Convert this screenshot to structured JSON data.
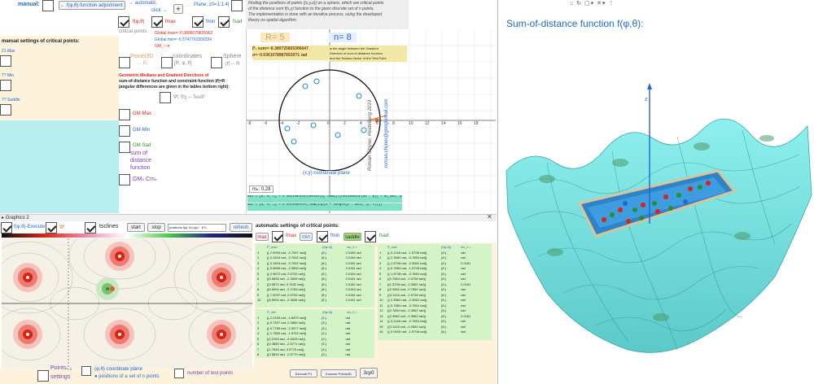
{
  "top": {
    "manual": "manual:",
    "phi_adjust": "f(φ,θ)-function adjustment:",
    "auto": "automatic.",
    "click": "click →",
    "plus": "+",
    "plane": "Plane: z0=1:1.4|",
    "desc": [
      "Finding the positions of points {(x,y,z)} on a sphere, which are critical points",
      "of the distance sum f(x,y) function to the given discrete set of n points.",
      "The implementation is done with an iterative process, using the developed",
      "theory on spatial algorithm."
    ]
  },
  "checks": {
    "fphi": "f(φ,θ)",
    "fmax": "fmax",
    "fmin": "fmin",
    "fsad": "fsad",
    "critical": "critical points"
  },
  "global": {
    "max": "Global  max=~0.3896079625962",
    "min": "Global  min=~0.3747761559334",
    "gm": "GM_~-π"
  },
  "points3d": "Points3D",
  "arrow": "→ P₁",
  "coordinates": "coordinates",
  "coords_val": "[R; φ; θ]",
  "sphere": "Sphere",
  "sphere_val": "|r⃗| ─ R",
  "geo": [
    "Geometric Medians and Gradient Directions of",
    "sum-of-distance function and constraint-function |r⃗|=R",
    "(angular differences are given in the tables bottom right):"
  ],
  "grad": "∇f, ∇χ ─ TestP",
  "gm_list": [
    "GM-Max",
    "GM-Min",
    "GM-Sad",
    "sum of",
    "distance",
    "function",
    "GMₙ Cmₙ"
  ],
  "manual_settings": "manual settings of critical points:",
  "side_items": [
    "21 Max",
    "7? Min",
    "7? Saddle"
  ],
  "graph": {
    "r": "R= 5",
    "n": "n= 8",
    "p_line1": "P₁  sum=~8.380725805306647",
    "p_line2": "   σ=~0.03610789876530?1 rad",
    "angle_note": [
      "is the angle between the Gradient",
      "Direction of sum-of-distance function",
      "and the Radius-Vector of the Test-Point"
    ],
    "author": "Roman Chijner, Heidelberg  2019",
    "email": "roman.chijner@googlemail.com",
    "xy_label": "(x,y) coordinate plane",
    "m": "mₙ: 0.28",
    "formula1": "AX1 = {0, 0, C} + R UnitVector(Vector(η, Sum(ζ/(UnitVector(AX - p)) * m)_AX1, p, 1}))}",
    "formula2": "AX2 = {0, 0, C} + R UnitVector(-Sum(Zip(z * Length(p - AX1), p, P))})",
    "xticks": [
      "-8",
      "-6",
      "-4",
      "-2",
      "0",
      "2",
      "4",
      "6",
      "8",
      "10",
      "12",
      "14",
      "16",
      "18"
    ],
    "yticks": [
      "6",
      "4",
      "2",
      "-2",
      "-4",
      "-6"
    ]
  },
  "graphics2": {
    "title": "Graphics 2",
    "fe": "f(φ,θ)-Execute",
    "fe2": "∇f",
    "tsclines": "tsclines",
    "start": "start",
    "stop": "stop",
    "positions": "positions f(φ, θ)=(φ1 · θ?)",
    "refresh": "refresh"
  },
  "auto_settings": "automatic settings of critical points:",
  "crit_btns": {
    "max": "max",
    "fmax": "fmax",
    "min": "min",
    "fmin": "fmin",
    "saddle": "saddle",
    "fsad": "fsad"
  },
  "table1": {
    "head": [
      "P_max",
      "(f(φ,θ))",
      "Δα_n ="
    ],
    "rows": [
      [
        "1",
        "{(-7.5993 rad, -2.7997 rad)}",
        "{8.}",
        "2.0180 rad"
      ],
      [
        "2",
        "{(-3.1816 rad, -0.7632 rad)}",
        "{8.}",
        "2.0184 rad"
      ],
      [
        "3",
        "{(-3.1816 rad, -0.7632 rad)}",
        "{8.}",
        "2.0181 rad"
      ],
      [
        "4",
        "{(-0.5896 rad, -2.3830 rad)}",
        "{8.}",
        "2.0181 rad"
      ],
      [
        "5",
        "{(-2.5872 rad, 0.5752 rad)}",
        "{8.}",
        "2.0184 rad"
      ],
      [
        "6",
        "{(0.5896 rad, -2.3839 rad)}",
        "{8.}",
        "2.0181 rad"
      ],
      [
        "7",
        "{(3.5872 rad, 0.7632 rad)}",
        "{8.}",
        "2.0181 rad"
      ],
      [
        "8",
        "{(5.5994 rad, -2.2783 rad)}",
        "{8.}",
        "2.0183 rad"
      ],
      [
        "9",
        "{(-7.5297 rad, 0.5752 rad)}",
        "{8.}",
        "2.0181 rad"
      ],
      [
        "10",
        "{(5.5994 rad, -2.3836 rad)}",
        "{8.}",
        "2.0181 rad"
      ]
    ]
  },
  "table2": {
    "head": [
      "P_min",
      "(f(φ,θ))",
      "Δα_n ="
    ],
    "rows": [
      [
        "1",
        "{(-2.2155 rad, -2.8575 rad)}",
        "{3.}",
        "rad"
      ],
      [
        "2",
        "{(-0.7457 rad, 0.3860 rad)}",
        "{3.}",
        "rad"
      ],
      [
        "3",
        "{(-0.7785 rad, -2.5577 rad)}",
        "{3.}",
        "rad"
      ],
      [
        "4",
        "{(-1.7853 rad, -1.5722 rad)}",
        "{3.}",
        "rad"
      ],
      [
        "5",
        "{(2.2153 rad, -0.5325 rad)}",
        "{3.}",
        "rad"
      ],
      [
        "6",
        "{(0.3889 rad, -2.5771 rad)}",
        "{3.}",
        "rad"
      ],
      [
        "7",
        "{(1.7845 rad, 0.5775 rad)}",
        "{3.}",
        "rad"
      ],
      [
        "8",
        "{(2.5815 rad, -2.5770 rad)}",
        "{3.}",
        "rad"
      ]
    ]
  },
  "table3": {
    "head": [
      "P_sad",
      "(f(φ,θ))",
      "Δα_n ="
    ],
    "rows": [
      [
        "1",
        "{(-3.1416 rad, -1.5708 rad)}",
        "{8.}",
        "rad"
      ],
      [
        "2",
        "{(-2.3562 rad, -0.7854 rad)}",
        "{8.}",
        "rad"
      ],
      [
        "3",
        "{(-1.5708 rad, -2.3562 rad)}",
        "{8.}",
        "2.0181"
      ],
      [
        "4",
        "{(-0.7854 rad, -1.5708 rad)}",
        "{8.}",
        "rad"
      ],
      [
        "5",
        "{(-1.5708 rad, -0.7854 rad)}",
        "{8.}",
        "rad"
      ],
      [
        "6",
        "{(0.7854 rad, -1.5708 rad)}",
        "{8.}",
        "rad"
      ],
      [
        "7",
        "{(1.5708 rad, -2.3562 rad)}",
        "{8.}",
        "2.0181"
      ],
      [
        "8",
        "{(2.3562 rad, -0.7854 rad)}",
        "{8.}",
        "rad"
      ],
      [
        "9",
        "{(3.1416 rad, -1.5708 rad)}",
        "{8.}",
        "rad"
      ],
      [
        "10",
        "{(-2.3562 rad, -2.3562 rad)}",
        "{8.}",
        "rad"
      ],
      [
        "11",
        "{(-0.7854 rad, -0.7854 rad)}",
        "{8.}",
        "rad"
      ],
      [
        "12",
        "{(0.7854 rad, -2.3562 rad)}",
        "{8.}",
        "rad"
      ],
      [
        "13",
        "{(2.3562 rad, -2.3562 rad)}",
        "{8.}",
        "2.0181"
      ],
      [
        "14",
        "{(-3.1416 rad, -0.7854 rad)}",
        "{8.}",
        "rad"
      ],
      [
        "15",
        "{(3.1416 rad, -2.3562 rad)}",
        "{8.}",
        "rad"
      ],
      [
        "16",
        "{(-0.0000 rad, -1.5708 rad)}",
        "{8.}",
        "rad"
      ]
    ]
  },
  "bottom": {
    "points": "Points₁,₂",
    "settings": "settings",
    "plane": "(φ,θ) coordinate plane",
    "positions": "● positions of a set of n points",
    "test": "number of test points",
    "b1": "Execute P1",
    "b2": "Execute Points3D",
    "b3": "3cp0"
  },
  "right": {
    "title": "Sum-of-distance function f(φ,θ):",
    "axis_z": "z"
  },
  "colors": {
    "accent": "#2366d1",
    "red": "#d21",
    "green": "#2a8f2a",
    "surface": "#7fe3e0"
  }
}
